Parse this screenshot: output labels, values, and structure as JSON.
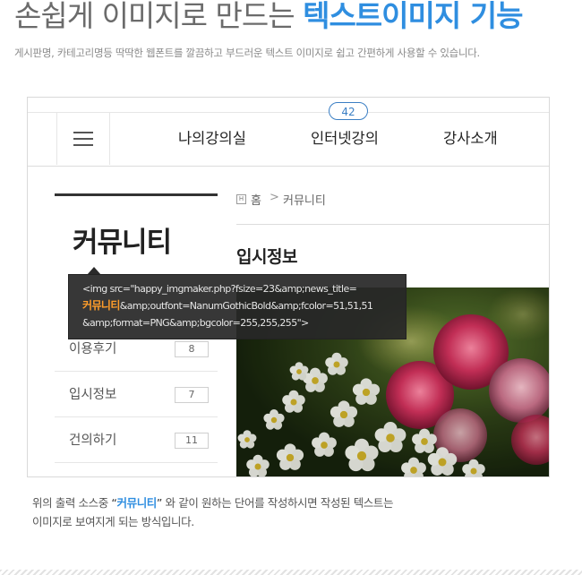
{
  "hero": {
    "title_plain": "손쉽게 이미지로 만드는 ",
    "title_accent": "텍스트이미지 기능",
    "subtitle": "게시판명, 카테고리명등 딱딱한 웹폰트를 깔끔하고 부드러운 텍스트 이미지로 쉽고 간편하게 사용할 수 있습니다."
  },
  "header": {
    "badge_count": "42",
    "nav": [
      "나의강의실",
      "인터넷강의",
      "강사소개"
    ]
  },
  "sidebar": {
    "title": "커뮤니티",
    "items": [
      {
        "label": "이용후기",
        "count": "8"
      },
      {
        "label": "입시정보",
        "count": "7"
      },
      {
        "label": "건의하기",
        "count": "11"
      }
    ]
  },
  "breadcrumb": {
    "home_icon": "H",
    "home": "홈",
    "separator": ">",
    "current": "커뮤니티"
  },
  "content": {
    "title": "입시정보"
  },
  "tooltip": {
    "line1": "<img src=\"happy_imgmaker.php?fsize=23&amp;news_title=",
    "line2_highlight": "커뮤니티",
    "line2_rest": "&amp;outfont=NanumGothicBold&amp;fcolor=51,51,51",
    "line3": "&amp;format=PNG&amp;bgcolor=255,255,255\">"
  },
  "caption": {
    "pre": "위의 출력 소스중 ",
    "open_quote": "“",
    "highlight": "커뮤니티",
    "close_quote": "”",
    "post": " 와 같이 원하는 단어를 작성하시면 작성된 텍스트는",
    "line2": "이미지로 보여지게 되는 방식입니다."
  },
  "colors": {
    "accent": "#2f8ee0",
    "tooltip_highlight": "#ff9d2a",
    "badge": "#3b7fc4"
  }
}
